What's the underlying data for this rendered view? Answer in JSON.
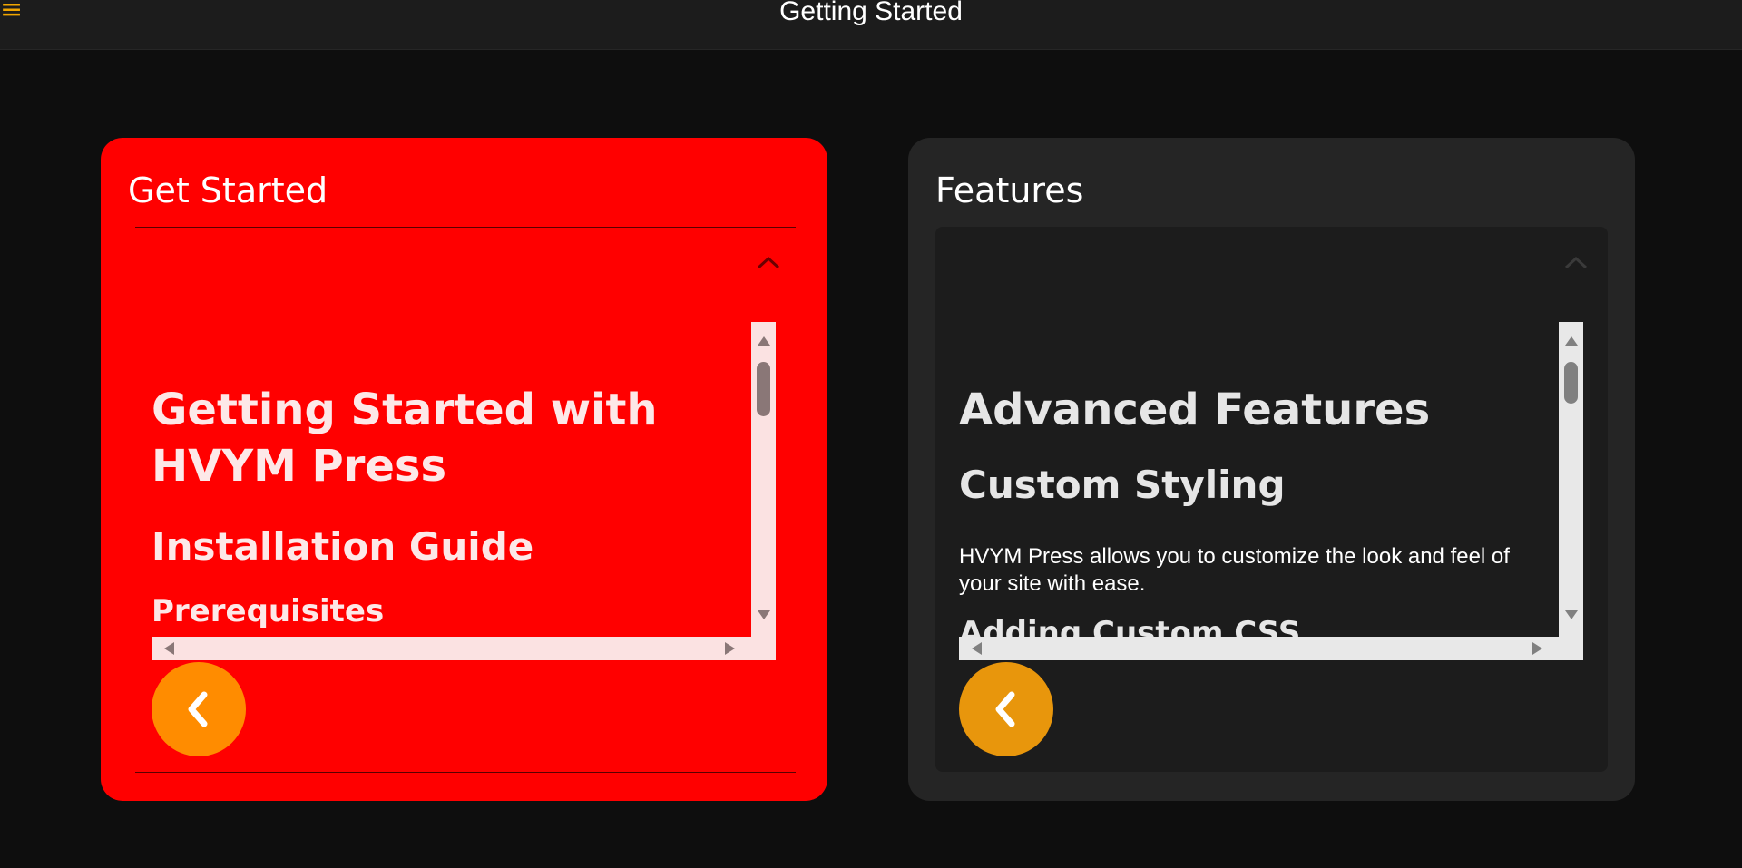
{
  "header": {
    "menu_icon": "≡",
    "title": "Getting Started"
  },
  "colors": {
    "accent": "#f0a500",
    "left_card_bg": "#ff0000",
    "right_card_bg": "#252525",
    "back_button_left": "#ff8c00",
    "back_button_right": "#e8960c"
  },
  "cards": [
    {
      "title": "Get Started",
      "icons": [
        "chevron-up-icon",
        "chevron-left-icon"
      ],
      "content": {
        "h1": "Getting Started with HVYM Press",
        "h2": "Installation Guide",
        "h3": "Prerequisites"
      }
    },
    {
      "title": "Features",
      "icons": [
        "chevron-up-icon",
        "chevron-left-icon"
      ],
      "content": {
        "h1": "Advanced Features",
        "h2": "Custom Styling",
        "p": "HVYM Press allows you to customize the look and feel of your site with ease.",
        "h3": "Adding Custom CSS"
      }
    }
  ]
}
